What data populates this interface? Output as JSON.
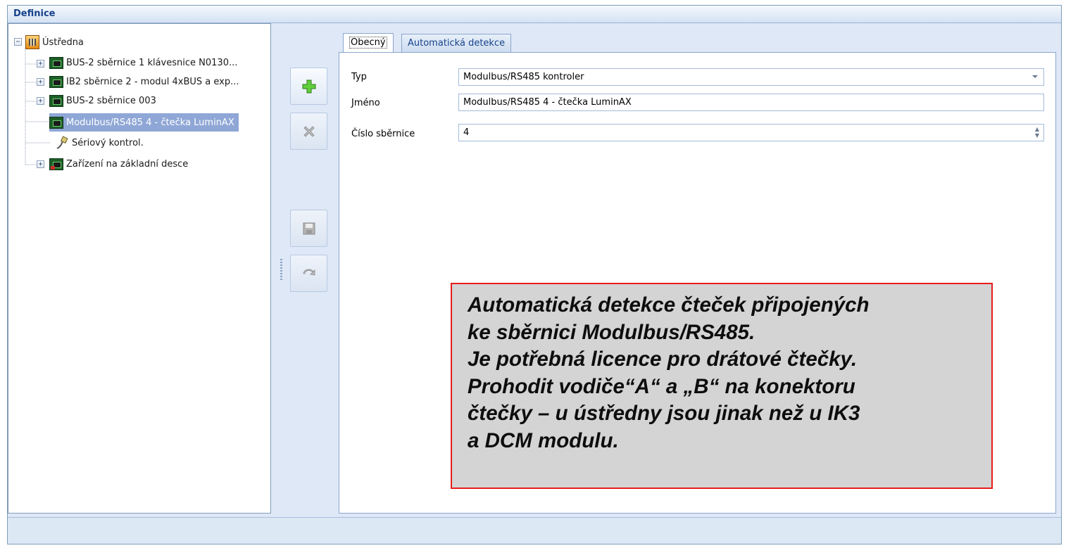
{
  "window": {
    "title": "Definice"
  },
  "tree": {
    "root": {
      "label": "Ústředna",
      "icon": "control-panel-icon"
    },
    "items": [
      {
        "label": "BUS-2 sběrnice 1 klávesnice N0130...",
        "icon": "circuit-board-icon",
        "expandable": true
      },
      {
        "label": "IB2 sběrnice 2 - modul 4xBUS a exp...",
        "icon": "circuit-board-icon",
        "expandable": true
      },
      {
        "label": "BUS-2 sběrnice 003",
        "icon": "circuit-board-icon",
        "expandable": true
      },
      {
        "label": "Modulbus/RS485  4 - čtečka LuminAX",
        "icon": "circuit-board-icon",
        "expandable": false,
        "selected": true
      },
      {
        "label": "Sériový kontrol.",
        "icon": "serial-cable-icon",
        "expandable": false
      },
      {
        "label": "Zařízení na základní desce",
        "icon": "mainboard-icon",
        "expandable": true
      }
    ]
  },
  "toolbar": {
    "add": "plus-icon",
    "delete": "delete-x-icon",
    "save": "save-disk-icon",
    "undo": "undo-icon"
  },
  "tabs": [
    {
      "label": "Obecný",
      "active": true
    },
    {
      "label": "Automatická detekce",
      "active": false
    }
  ],
  "form": {
    "type_label": "Typ",
    "type_value": "Modulbus/RS485 kontroler",
    "name_label": "Jméno",
    "name_value": "Modulbus/RS485  4 - čtečka LuminAX",
    "bus_label": "Číslo sběrnice",
    "bus_value": "4"
  },
  "note": {
    "lines": [
      "Automatická detekce čteček připojených",
      "ke sběrnici Modulbus/RS485.",
      "Je potřebná licence pro drátové čtečky.",
      "Prohodit vodiče“A“ a „B“ na konektoru",
      "čtečky – u ústředny jsou jinak než u IK3",
      "a DCM modulu."
    ]
  },
  "colors": {
    "selection": "#8fa7d6",
    "note_border": "#e61c1c",
    "note_background": "#d4d4d4",
    "title_text": "#15428b"
  }
}
